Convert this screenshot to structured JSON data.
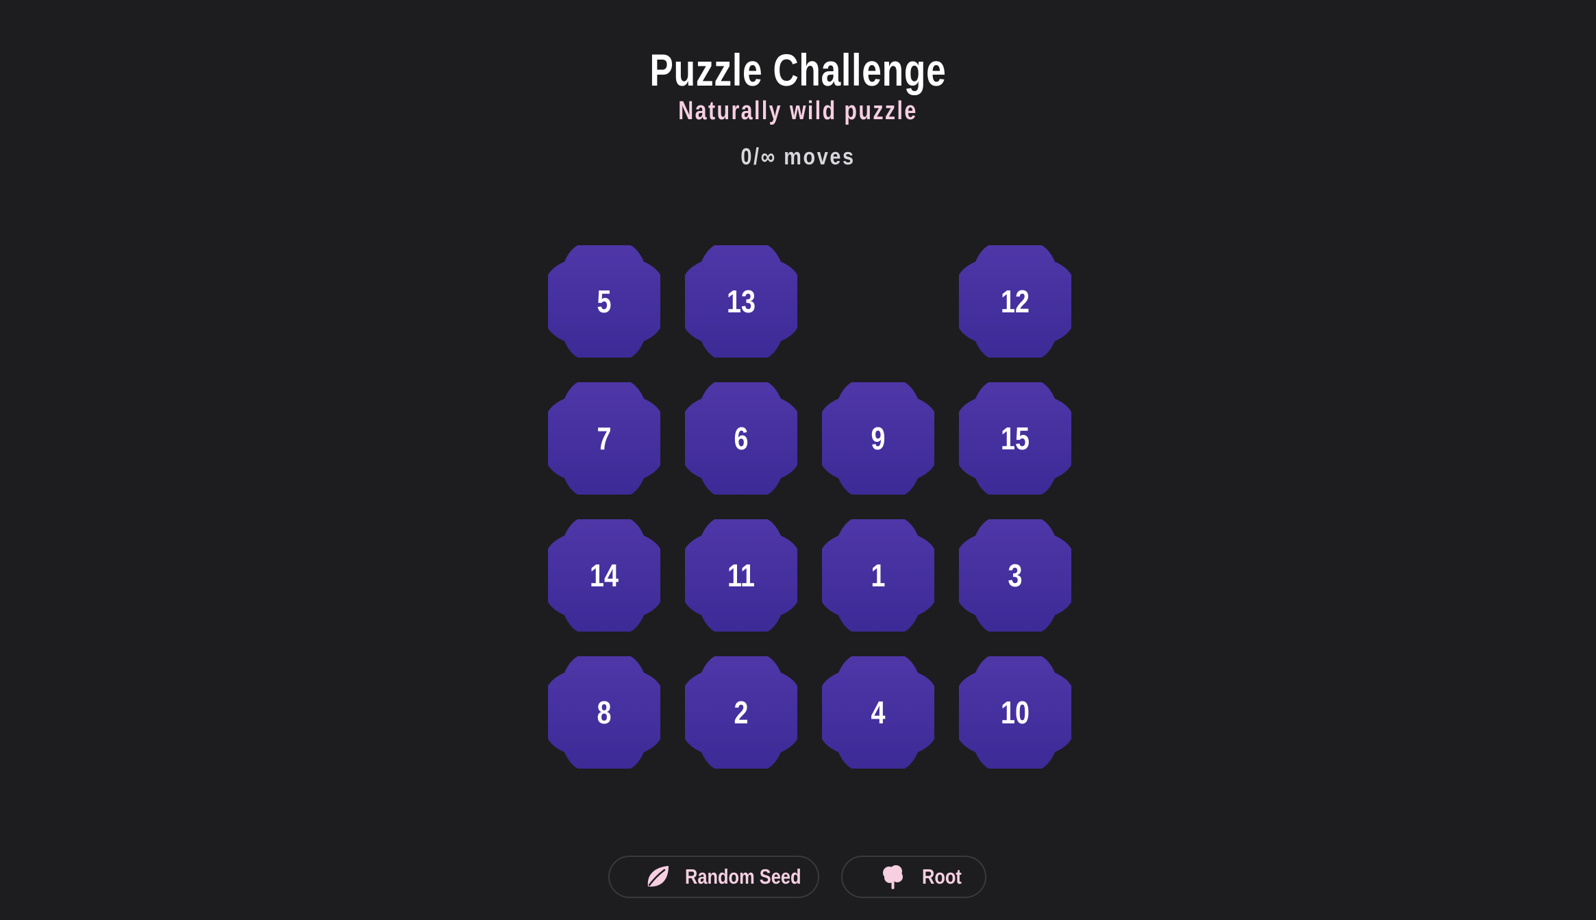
{
  "header": {
    "title": "Puzzle Challenge",
    "subtitle": "Naturally wild puzzle"
  },
  "status": {
    "moves": "0/∞ moves"
  },
  "board": {
    "rows": 4,
    "cols": 4,
    "tiles": [
      "5",
      "13",
      "",
      "12",
      "7",
      "6",
      "9",
      "15",
      "14",
      "11",
      "1",
      "3",
      "8",
      "2",
      "4",
      "10"
    ],
    "tile_color_top": "#4f37a8",
    "tile_color_bottom": "#3c2a96"
  },
  "controls": {
    "random_seed_label": "Random Seed",
    "random_seed_icon": "leaf-icon",
    "root_label": "Root",
    "root_icon": "tree-icon"
  },
  "colors": {
    "background": "#1d1d1f",
    "accent": "#f6cfe1",
    "title": "#ffffff"
  }
}
